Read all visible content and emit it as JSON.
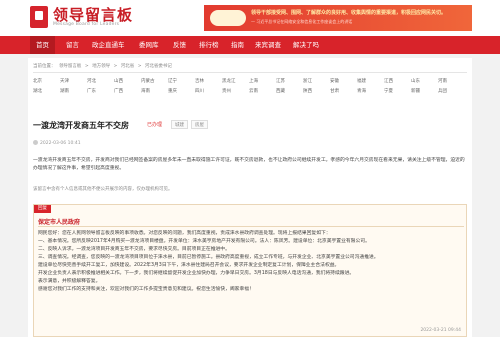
{
  "site": {
    "logo_title": "领导留言板",
    "logo_subtitle": "Message Board for Leaders"
  },
  "banner": {
    "headline": "领导干部接受网、围网、了解群众的良好用、收集舆情的重要渠道，积极回应网民关切。",
    "subline": "— 习近平总书记在网络安全和信息化工作座谈会上的讲话"
  },
  "nav": {
    "items": [
      "首页",
      "留言",
      "政企直通车",
      "委网库",
      "反馈",
      "排行榜",
      "指南",
      "来宾调查",
      "解决了吗"
    ],
    "active_index": 0
  },
  "breadcrumb": [
    "当前位置：",
    "领导留言板",
    ">",
    "地方领导",
    ">",
    "河北省",
    ">",
    "河北省委书记"
  ],
  "regions": {
    "row1": [
      "北京",
      "天津",
      "河北",
      "山西",
      "内蒙古",
      "辽宁",
      "吉林",
      "黑龙江",
      "上海",
      "江苏",
      "浙江",
      "安徽",
      "福建",
      "江西",
      "山东",
      "河南"
    ],
    "row2": [
      "湖北",
      "湖南",
      "广东",
      "广西",
      "海南",
      "重庆",
      "四川",
      "贵州",
      "云南",
      "西藏",
      "陕西",
      "甘肃",
      "青海",
      "宁夏",
      "新疆",
      "兵团"
    ]
  },
  "message": {
    "title": "一渡龙湾开发商五年不交房",
    "status": "已办理",
    "tags": [
      "城建",
      "房屋"
    ],
    "time": "2022-03-06 10:41",
    "content": "一渡龙湾开发商五年不交房，开发商对我们已经网签备案的房屋多年未一直未取得施工许可证，既不交房退款，也不让政府公司继续开发工。孝感的今年六月交房现在看来无果，请关注上级不管理，迫近的办理情况了解这件事，希望引起高度重视。"
  },
  "hint": "该留言中含有个人信息或其他不便公开展示的内容，仅办理机构可见。",
  "reply": {
    "label": "回复",
    "org": "保定市人民政府",
    "paragraphs": [
      "网民您好：您在人民网领导留言板反映的事项收悉。对您反映的问题，我们高度重视，责成涞水县政府调查处理。现将上报结果回复如下：",
      "一、基本情况。您所反映2017年4月购买一渡龙湾项目楼盘。开发单位：涞水美亨房地产开发有限公司。法人：陈凤芳。建设单位：北京美亨置业有限公司。",
      "二、反映人诉求。一渡龙湾项目开发商五年不交房，要求尽快交房。目前项目正在推进中。",
      "三、调查情况。经调查，您反映的一渡龙湾项目项目位于涞水县，目前已暂停施工。县政府高度重视，成立工作专班，与开发企业、北京美亨置业公司沟通推进。",
      "建设单位尽快完善手续开工复工，加快建设。2022年3月3日下午，涞水县住建局召开会议，要求开发企业制定复工计划，保障业主合法权益。",
      "开发企业负责人表示积极推进相关工作。下一步，我们将继续督促开发企业加快办理，力争早日交房。3月18日与反映人电话沟通，我们将持续跟进。",
      "表示满意，并积极解释答复。",
      "感谢您对我们工作的支持和关注，欢迎对我们的工作多提宝贵意见和建议。祝您生活愉快，阖家幸福！"
    ],
    "date": "2022-03-21 09:44"
  }
}
